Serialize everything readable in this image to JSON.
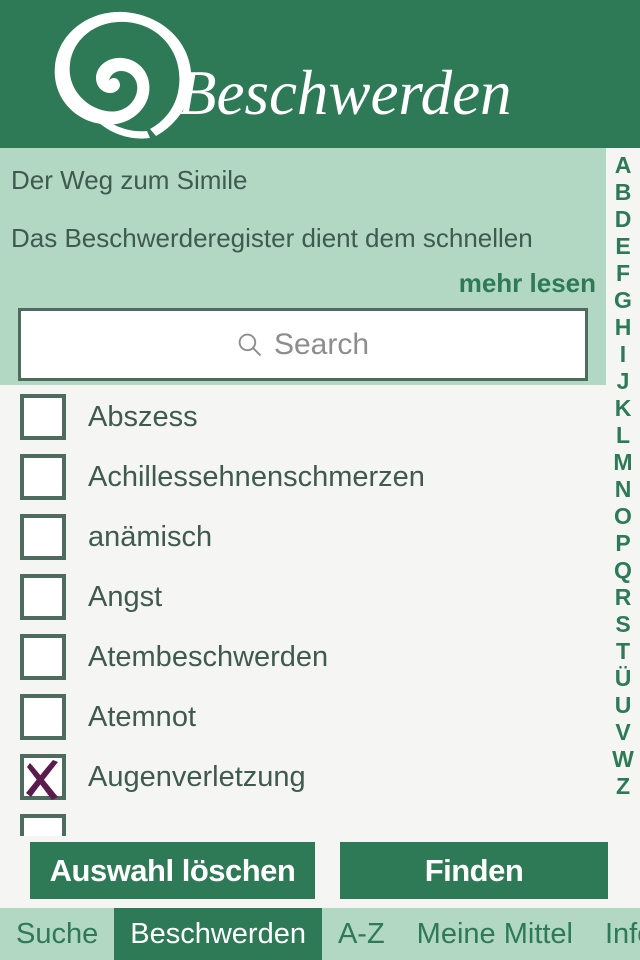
{
  "header": {
    "title": "Beschwerden",
    "logo_name": "spiral-logo"
  },
  "intro": {
    "title": "Der Weg zum Simile",
    "body": "Das Beschwerderegister dient dem schnellen",
    "more_link": "mehr lesen"
  },
  "search": {
    "placeholder": "Search",
    "value": "",
    "icon": "search-icon"
  },
  "alpha_index": [
    "A",
    "B",
    "D",
    "E",
    "F",
    "G",
    "H",
    "I",
    "J",
    "K",
    "L",
    "M",
    "N",
    "O",
    "P",
    "Q",
    "R",
    "S",
    "T",
    "Ü",
    "U",
    "V",
    "W",
    "Z"
  ],
  "list": {
    "items": [
      {
        "label": "Abszess",
        "checked": false
      },
      {
        "label": "Achillessehnenschmerzen",
        "checked": false
      },
      {
        "label": "anämisch",
        "checked": false
      },
      {
        "label": "Angst",
        "checked": false
      },
      {
        "label": "Atembeschwerden",
        "checked": false
      },
      {
        "label": "Atemnot",
        "checked": false
      },
      {
        "label": "Augenverletzung",
        "checked": true
      },
      {
        "label": "",
        "checked": false
      }
    ]
  },
  "actions": {
    "clear_label": "Auswahl löschen",
    "find_label": "Finden"
  },
  "tabs": [
    {
      "label": "Suche",
      "active": false
    },
    {
      "label": "Beschwerden",
      "active": true
    },
    {
      "label": "A-Z",
      "active": false
    },
    {
      "label": "Meine Mittel",
      "active": false
    },
    {
      "label": "Info",
      "active": false
    }
  ],
  "colors": {
    "brand_green": "#2e7a56",
    "panel_green": "#b2d7c3",
    "text_green": "#3f5a4e",
    "paper": "#f5f5f4",
    "check_mark": "#5c1b4d",
    "box_border": "#4d6b5e"
  }
}
